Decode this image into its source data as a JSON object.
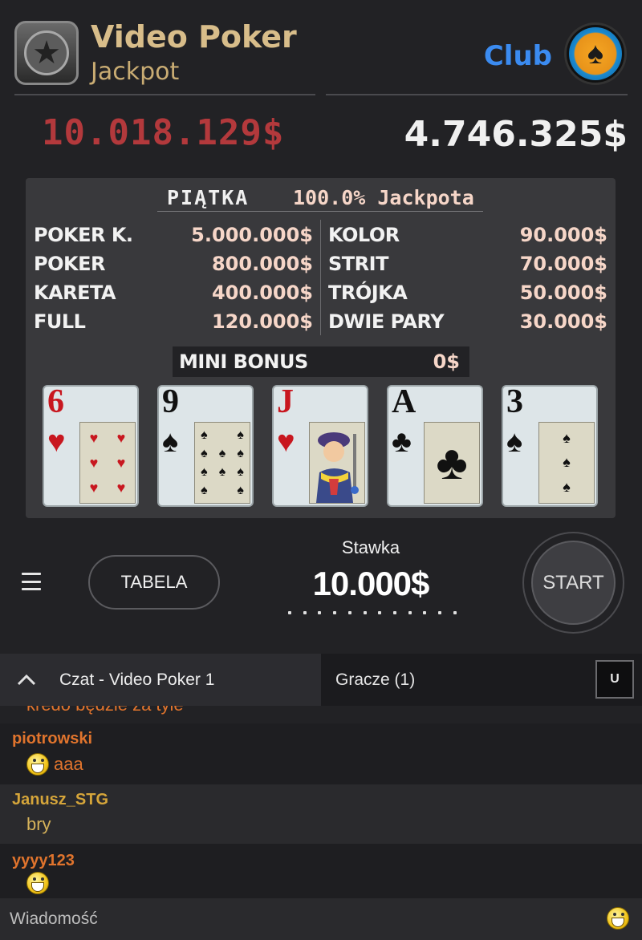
{
  "header": {
    "title": "Video Poker",
    "subtitle": "Jackpot",
    "club_label": "Club",
    "jackpot_amount": "10.018.129$",
    "club_amount": "4.746.325$"
  },
  "paytable": {
    "top_hand": "PIĄTKA",
    "top_value": "100.0% Jackpota",
    "left": [
      {
        "name": "POKER K.",
        "value": "5.000.000$"
      },
      {
        "name": "POKER",
        "value": "800.000$"
      },
      {
        "name": "KARETA",
        "value": "400.000$"
      },
      {
        "name": "FULL",
        "value": "120.000$"
      }
    ],
    "right": [
      {
        "name": "KOLOR",
        "value": "90.000$"
      },
      {
        "name": "STRIT",
        "value": "70.000$"
      },
      {
        "name": "TRÓJKA",
        "value": "50.000$"
      },
      {
        "name": "DWIE PARY",
        "value": "30.000$"
      }
    ],
    "mini_bonus_label": "MINI BONUS",
    "mini_bonus_value": "0$"
  },
  "cards": [
    {
      "rank": "6",
      "suit": "♥",
      "color": "#c8171f"
    },
    {
      "rank": "9",
      "suit": "♠",
      "color": "#111111"
    },
    {
      "rank": "J",
      "suit": "♥",
      "color": "#c8171f"
    },
    {
      "rank": "A",
      "suit": "♣",
      "color": "#111111"
    },
    {
      "rank": "3",
      "suit": "♠",
      "color": "#111111"
    }
  ],
  "controls": {
    "tabela_label": "TABELA",
    "stake_label": "Stawka",
    "stake_value": "10.000$",
    "start_label": "START"
  },
  "chat": {
    "chat_tab_label": "Czat - Video Poker 1",
    "players_tab_label": "Gracze  (1)",
    "u_button_label": "U",
    "partial_message": "kredo będzie za tyle",
    "messages": [
      {
        "user": "piotrowski",
        "user_color": "#e0742d",
        "text": "aaa",
        "emoji": true
      },
      {
        "user": "Janusz_STG",
        "user_color": "#d5a53a",
        "text": "bry",
        "emoji": false
      },
      {
        "user": "yyyy123",
        "user_color": "#e0742d",
        "text": "",
        "emoji": true
      }
    ],
    "input_placeholder": "Wiadomość"
  },
  "icons": {
    "logo": "star-icon",
    "club": "spade-badge-icon",
    "menu": "hamburger-menu-icon",
    "chat_toggle": "chevron-up-icon",
    "emoji": "laughing-smiley-icon"
  }
}
